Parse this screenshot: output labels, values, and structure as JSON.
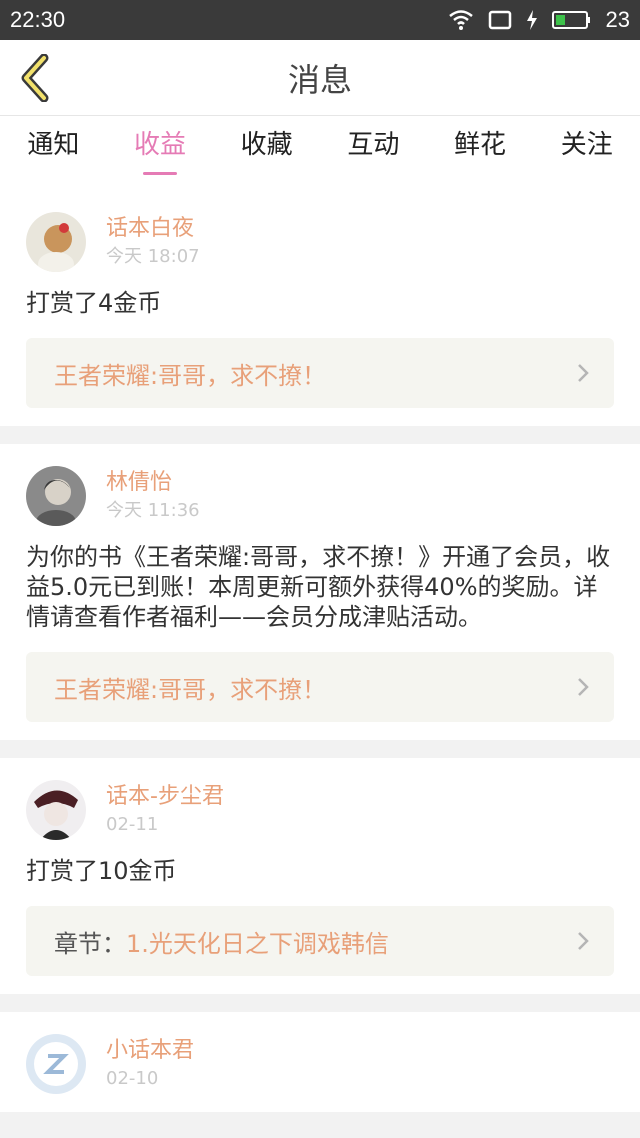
{
  "status": {
    "time": "22:30",
    "battery": "23"
  },
  "nav": {
    "title": "消息"
  },
  "tabs": [
    "通知",
    "收益",
    "收藏",
    "互动",
    "鲜花",
    "关注"
  ],
  "active_tab_index": 1,
  "colors": {
    "accent_pink": "#e57bb5",
    "name_orange": "#e8a079"
  },
  "messages": [
    {
      "name": "话本白夜",
      "time": "今天  18:07",
      "text": "打赏了4金币",
      "link_prefix": "",
      "link": "王者荣耀:哥哥，求不撩！",
      "avatar_icon": "girl-avatar"
    },
    {
      "name": "林倩怡",
      "time": "今天  11:36",
      "text": "为你的书《王者荣耀:哥哥，求不撩！》开通了会员，收益5.0元已到账！本周更新可额外获得40%的奖励。详情请查看作者福利——会员分成津贴活动。",
      "link_prefix": "",
      "link": "王者荣耀:哥哥，求不撩！",
      "avatar_icon": "grey-avatar"
    },
    {
      "name": "话本-步尘君",
      "time": "02-11",
      "text": "打赏了10金币",
      "link_prefix": "章节：",
      "link": "1.光天化日之下调戏韩信",
      "avatar_icon": "anime-avatar"
    },
    {
      "name": "小话本君",
      "time": "02-10",
      "avatar_icon": "logo-avatar"
    }
  ]
}
